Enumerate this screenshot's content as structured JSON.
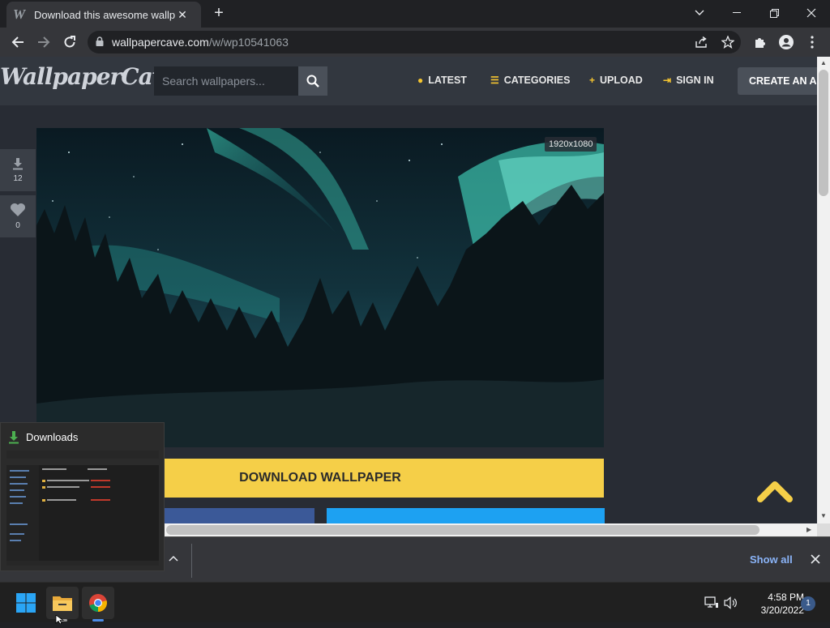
{
  "browser": {
    "tab_title": "Download this awesome wallpaper",
    "tab_favicon": "W",
    "url_host": "wallpapercave.com",
    "url_path": "/w/wp10541063"
  },
  "site": {
    "logo_text": "WallpaperCave",
    "search_placeholder": "Search wallpapers...",
    "nav": {
      "latest": "LATEST",
      "categories": "CATEGORIES",
      "upload": "UPLOAD",
      "sign_in": "SIGN IN",
      "create_account": "CREATE AN ACCOUNT"
    },
    "downloads_count": "12",
    "likes_count": "0",
    "resolution": "1920x1080",
    "download_button": "DOWNLOAD WALLPAPER",
    "colors": {
      "accent": "#f5cf48",
      "facebook": "#3b5998",
      "twitter": "#1da1f2"
    }
  },
  "shelf": {
    "show_all": "Show all"
  },
  "thumbnail": {
    "title": "Downloads"
  },
  "taskbar": {
    "time": "4:58 PM",
    "date": "3/20/2022",
    "notification_count": "1"
  }
}
